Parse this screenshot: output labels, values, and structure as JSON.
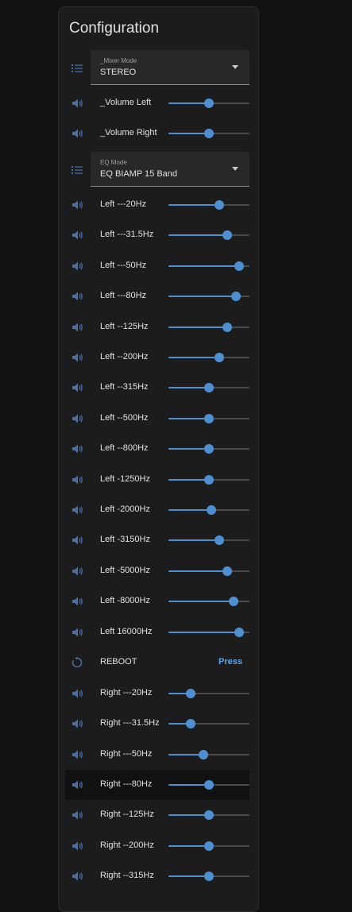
{
  "card": {
    "title": "Configuration"
  },
  "colors": {
    "accent": "#4e8fd1",
    "icon": "#4a6fa5",
    "link": "#5aaaf0",
    "background": "#111111",
    "card": "#1c1c1c"
  },
  "mixer_mode": {
    "label": "_Mixer Mode",
    "value": "STEREO",
    "icon": "format-list-icon"
  },
  "volume": [
    {
      "name": "_Volume Left",
      "level": 0.5,
      "icon": "volume-icon"
    },
    {
      "name": "_Volume Right",
      "level": 0.5,
      "icon": "volume-icon"
    }
  ],
  "eq_mode": {
    "label": "EQ Mode",
    "value": "EQ BIAMP 15 Band",
    "icon": "format-list-icon"
  },
  "left_bands": [
    {
      "name": "Left ---20Hz",
      "level": 0.63
    },
    {
      "name": "Left ---31.5Hz",
      "level": 0.73
    },
    {
      "name": "Left ---50Hz",
      "level": 0.87
    },
    {
      "name": "Left ---80Hz",
      "level": 0.83
    },
    {
      "name": "Left --125Hz",
      "level": 0.73
    },
    {
      "name": "Left --200Hz",
      "level": 0.63
    },
    {
      "name": "Left --315Hz",
      "level": 0.5
    },
    {
      "name": "Left --500Hz",
      "level": 0.5
    },
    {
      "name": "Left --800Hz",
      "level": 0.5
    },
    {
      "name": "Left -1250Hz",
      "level": 0.5
    },
    {
      "name": "Left -2000Hz",
      "level": 0.53
    },
    {
      "name": "Left -3150Hz",
      "level": 0.63
    },
    {
      "name": "Left -5000Hz",
      "level": 0.73
    },
    {
      "name": "Left -8000Hz",
      "level": 0.8
    },
    {
      "name": "Left 16000Hz",
      "level": 0.87
    }
  ],
  "reboot": {
    "name": "REBOOT",
    "action": "Press",
    "icon": "restart-icon"
  },
  "right_bands": [
    {
      "name": "Right ---20Hz",
      "level": 0.27
    },
    {
      "name": "Right ---31.5Hz",
      "level": 0.27
    },
    {
      "name": "Right ---50Hz",
      "level": 0.43
    },
    {
      "name": "Right ---80Hz",
      "level": 0.5
    },
    {
      "name": "Right --125Hz",
      "level": 0.5
    },
    {
      "name": "Right --200Hz",
      "level": 0.5
    },
    {
      "name": "Right --315Hz",
      "level": 0.5
    }
  ]
}
